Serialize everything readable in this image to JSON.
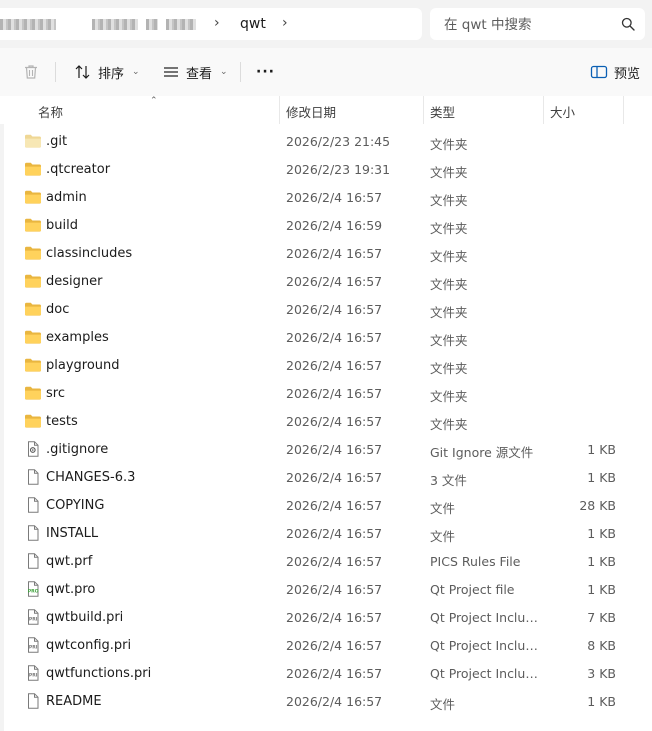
{
  "address": {
    "current_folder": "qwt",
    "separator": "›"
  },
  "search": {
    "placeholder": "在 qwt 中搜索"
  },
  "toolbar": {
    "sort_label": "排序",
    "view_label": "查看",
    "more_label": "···",
    "preview_label": "预览"
  },
  "columns": {
    "name": "名称",
    "date": "修改日期",
    "type": "类型",
    "size": "大小"
  },
  "files": [
    {
      "name": ".git",
      "date": "2026/2/23 21:45",
      "type": "文件夹",
      "size": "",
      "icon": "folder-light-icon"
    },
    {
      "name": ".qtcreator",
      "date": "2026/2/23 19:31",
      "type": "文件夹",
      "size": "",
      "icon": "folder-icon"
    },
    {
      "name": "admin",
      "date": "2026/2/4 16:57",
      "type": "文件夹",
      "size": "",
      "icon": "folder-icon"
    },
    {
      "name": "build",
      "date": "2026/2/4 16:59",
      "type": "文件夹",
      "size": "",
      "icon": "folder-icon"
    },
    {
      "name": "classincludes",
      "date": "2026/2/4 16:57",
      "type": "文件夹",
      "size": "",
      "icon": "folder-icon"
    },
    {
      "name": "designer",
      "date": "2026/2/4 16:57",
      "type": "文件夹",
      "size": "",
      "icon": "folder-icon"
    },
    {
      "name": "doc",
      "date": "2026/2/4 16:57",
      "type": "文件夹",
      "size": "",
      "icon": "folder-icon"
    },
    {
      "name": "examples",
      "date": "2026/2/4 16:57",
      "type": "文件夹",
      "size": "",
      "icon": "folder-icon"
    },
    {
      "name": "playground",
      "date": "2026/2/4 16:57",
      "type": "文件夹",
      "size": "",
      "icon": "folder-icon"
    },
    {
      "name": "src",
      "date": "2026/2/4 16:57",
      "type": "文件夹",
      "size": "",
      "icon": "folder-icon"
    },
    {
      "name": "tests",
      "date": "2026/2/4 16:57",
      "type": "文件夹",
      "size": "",
      "icon": "folder-icon"
    },
    {
      "name": ".gitignore",
      "date": "2026/2/4 16:57",
      "type": "Git Ignore 源文件",
      "size": "1 KB",
      "icon": "gear-file-icon"
    },
    {
      "name": "CHANGES-6.3",
      "date": "2026/2/4 16:57",
      "type": "3 文件",
      "size": "1 KB",
      "icon": "file-icon"
    },
    {
      "name": "COPYING",
      "date": "2026/2/4 16:57",
      "type": "文件",
      "size": "28 KB",
      "icon": "file-icon"
    },
    {
      "name": "INSTALL",
      "date": "2026/2/4 16:57",
      "type": "文件",
      "size": "1 KB",
      "icon": "file-icon"
    },
    {
      "name": "qwt.prf",
      "date": "2026/2/4 16:57",
      "type": "PICS Rules File",
      "size": "1 KB",
      "icon": "file-icon"
    },
    {
      "name": "qwt.pro",
      "date": "2026/2/4 16:57",
      "type": "Qt Project file",
      "size": "1 KB",
      "icon": "qt-pro-file-icon"
    },
    {
      "name": "qwtbuild.pri",
      "date": "2026/2/4 16:57",
      "type": "Qt Project Includ...",
      "size": "7 KB",
      "icon": "qt-pri-file-icon"
    },
    {
      "name": "qwtconfig.pri",
      "date": "2026/2/4 16:57",
      "type": "Qt Project Includ...",
      "size": "8 KB",
      "icon": "qt-pri-file-icon"
    },
    {
      "name": "qwtfunctions.pri",
      "date": "2026/2/4 16:57",
      "type": "Qt Project Includ...",
      "size": "3 KB",
      "icon": "qt-pri-file-icon"
    },
    {
      "name": "README",
      "date": "2026/2/4 16:57",
      "type": "文件",
      "size": "1 KB",
      "icon": "file-icon"
    }
  ]
}
